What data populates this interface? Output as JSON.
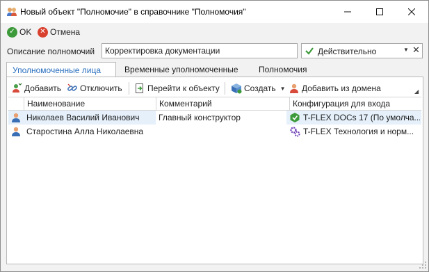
{
  "window": {
    "title": "Новый объект \"Полномочие\" в справочнике \"Полномочия\"",
    "icon": "users-icon"
  },
  "actions": {
    "ok_label": "OK",
    "cancel_label": "Отмена"
  },
  "form": {
    "description_label": "Описание полномочий",
    "description_value": "Корректировка документации",
    "status_value": "Действительно"
  },
  "tabs": [
    {
      "label": "Уполномоченные лица",
      "active": true
    },
    {
      "label": "Временные уполномоченные",
      "active": false
    },
    {
      "label": "Полномочия",
      "active": false
    }
  ],
  "toolbar": {
    "add_label": "Добавить",
    "disconnect_label": "Отключить",
    "goto_label": "Перейти к объекту",
    "create_label": "Создать",
    "add_from_domain_label": "Добавить из домена"
  },
  "grid": {
    "columns": [
      "Наименование",
      "Комментарий",
      "Конфигурация для входа"
    ],
    "rows": [
      {
        "name": "Николаев Василий Иванович",
        "comment": "Главный конструктор",
        "config": "T-FLEX DOCs 17 (По умолча...",
        "config_icon": "docs-icon"
      },
      {
        "name": "Старостина Алла Николаевна",
        "comment": "",
        "config": "T-FLEX Технология и норм...",
        "config_icon": "gear-icon"
      }
    ]
  },
  "colors": {
    "accent": "#2a6fbe",
    "selection": "#e5f0fb",
    "ok": "#3d9a3a",
    "cancel": "#d9412f"
  }
}
